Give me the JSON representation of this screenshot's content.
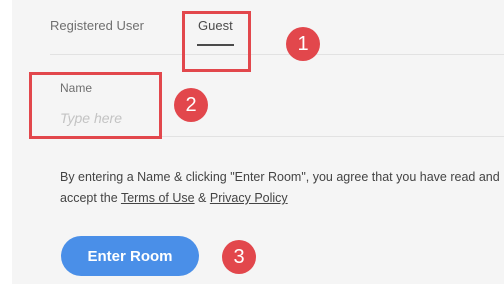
{
  "tabs": {
    "registered_label": "Registered User",
    "guest_label": "Guest",
    "active": "Guest"
  },
  "name_field": {
    "label": "Name",
    "placeholder": "Type here",
    "value": ""
  },
  "disclaimer": {
    "text_before": "By entering a Name & clicking \"Enter Room\", you agree that you have read and accept the ",
    "terms_link": "Terms of Use",
    "separator": " & ",
    "privacy_link": "Privacy Policy"
  },
  "enter_button_label": "Enter Room",
  "annotations": {
    "marker_1": "1",
    "marker_2": "2",
    "marker_3": "3",
    "color": "#e2474c"
  },
  "colors": {
    "accent_button": "#4a8fe8",
    "panel_background": "#f5f5f5"
  }
}
